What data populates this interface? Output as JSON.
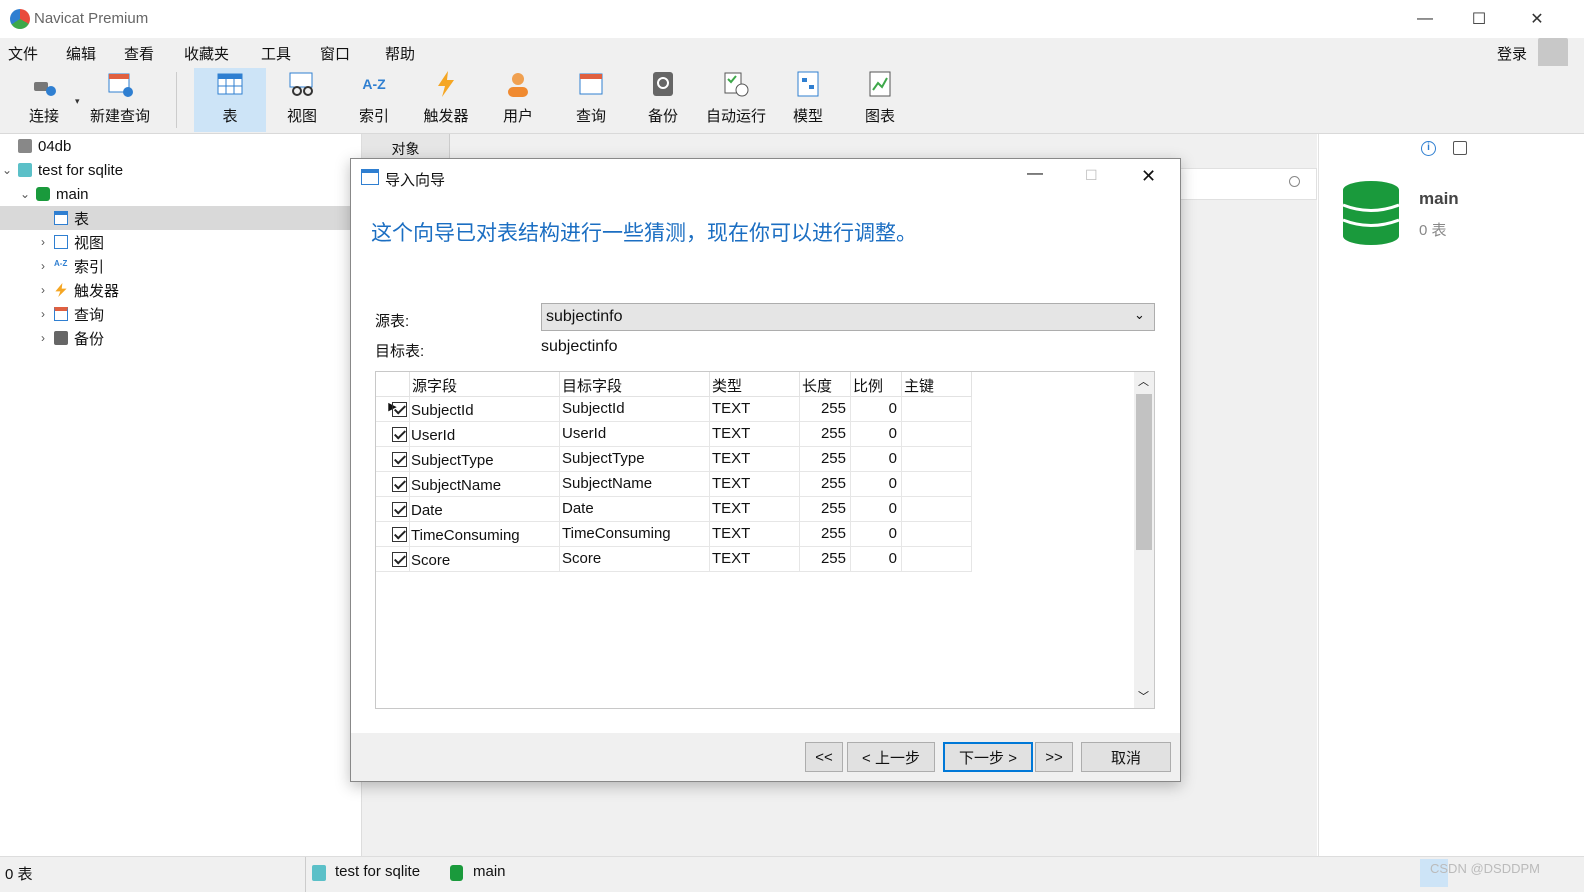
{
  "app": {
    "title": "Navicat Premium",
    "login": "登录"
  },
  "menu": [
    "文件",
    "编辑",
    "查看",
    "收藏夹",
    "工具",
    "窗口",
    "帮助"
  ],
  "toolbar": [
    "连接",
    "新建查询",
    "表",
    "视图",
    "索引",
    "触发器",
    "用户",
    "查询",
    "备份",
    "自动运行",
    "模型",
    "图表"
  ],
  "toolbar_icon_text": {
    "index": "A-Z"
  },
  "tree": {
    "db1": "04db",
    "conn": "test for sqlite",
    "schema": "main",
    "items": [
      "表",
      "视图",
      "索引",
      "触发器",
      "查询",
      "备份"
    ]
  },
  "tab": {
    "objects": "对象"
  },
  "info": {
    "name": "main",
    "count": "0 表"
  },
  "status": {
    "count": "0 表",
    "conn": "test for sqlite",
    "schema": "main",
    "watermark": "CSDN @DSDDPM"
  },
  "dialog": {
    "title": "导入向导",
    "headline": "这个向导已对表结构进行一些猜测，现在你可以进行调整。",
    "source_label": "源表:",
    "source_value": "subjectinfo",
    "target_label": "目标表:",
    "target_value": "subjectinfo",
    "columns": [
      "源字段",
      "目标字段",
      "类型",
      "长度",
      "比例",
      "主键"
    ],
    "rows": [
      [
        "SubjectId",
        "SubjectId",
        "TEXT",
        "255",
        "0",
        ""
      ],
      [
        "UserId",
        "UserId",
        "TEXT",
        "255",
        "0",
        ""
      ],
      [
        "SubjectType",
        "SubjectType",
        "TEXT",
        "255",
        "0",
        ""
      ],
      [
        "SubjectName",
        "SubjectName",
        "TEXT",
        "255",
        "0",
        ""
      ],
      [
        "Date",
        "Date",
        "TEXT",
        "255",
        "0",
        ""
      ],
      [
        "TimeConsuming",
        "TimeConsuming",
        "TEXT",
        "255",
        "0",
        ""
      ],
      [
        "Score",
        "Score",
        "TEXT",
        "255",
        "0",
        ""
      ]
    ],
    "buttons": {
      "first": "<<",
      "prev": "< 上一步",
      "next": "下一步 >",
      "last": ">>",
      "cancel": "取消"
    }
  },
  "colors": {
    "accent": "#1b6ec2",
    "db_green": "#1a9a3c",
    "selected": "#cde4f7"
  }
}
